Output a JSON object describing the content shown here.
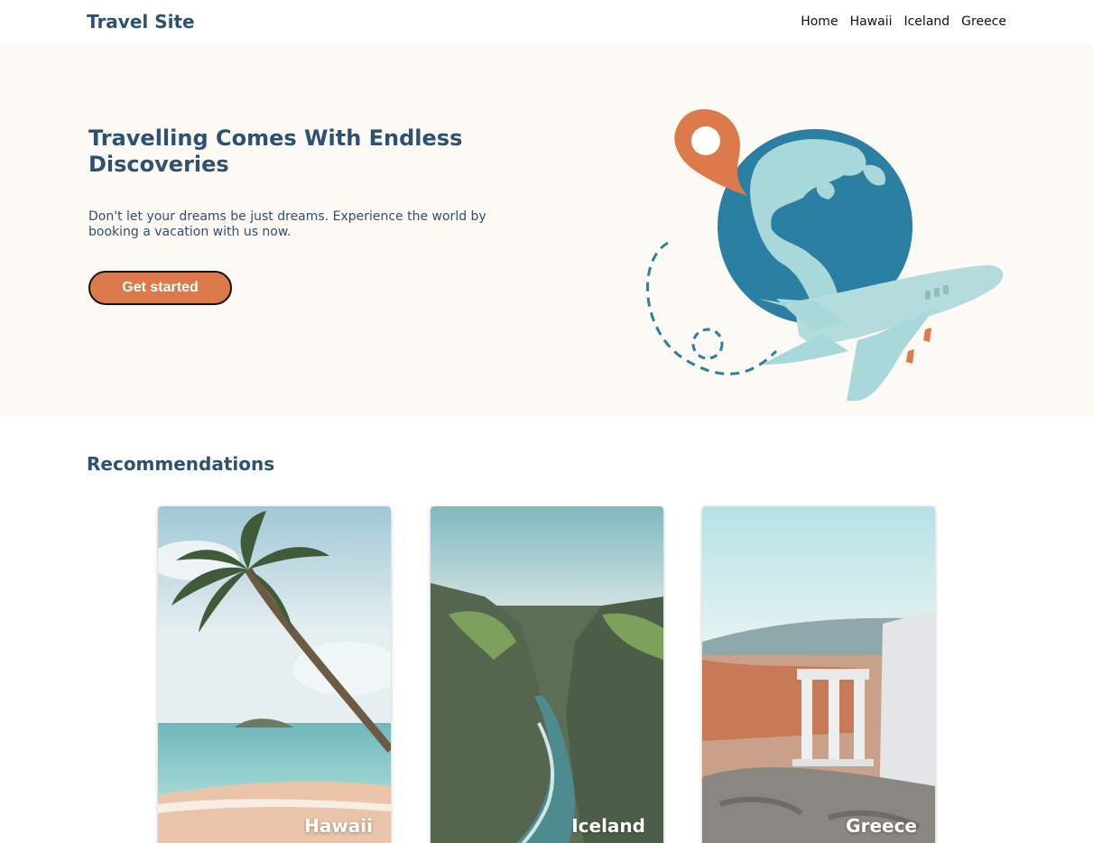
{
  "nav": {
    "brand": "Travel Site",
    "links": [
      "Home",
      "Hawaii",
      "Iceland",
      "Greece"
    ]
  },
  "hero": {
    "title": "Travelling Comes With Endless Discoveries",
    "text": "Don't let your dreams be just dreams. Experience the world by booking a vacation with us now.",
    "cta": "Get started"
  },
  "recommendations": {
    "title": "Recommendations",
    "cards": [
      {
        "label": "Hawaii"
      },
      {
        "label": "Iceland"
      },
      {
        "label": "Greece"
      }
    ]
  },
  "colors": {
    "brand": "#2e5170",
    "accent": "#dd7a4b",
    "hero_bg": "#fdf9f4",
    "globe_ocean": "#2a7fa3",
    "globe_land": "#a8d8da"
  },
  "icons": [
    "map-pin-icon",
    "globe-icon",
    "airplane-icon"
  ]
}
